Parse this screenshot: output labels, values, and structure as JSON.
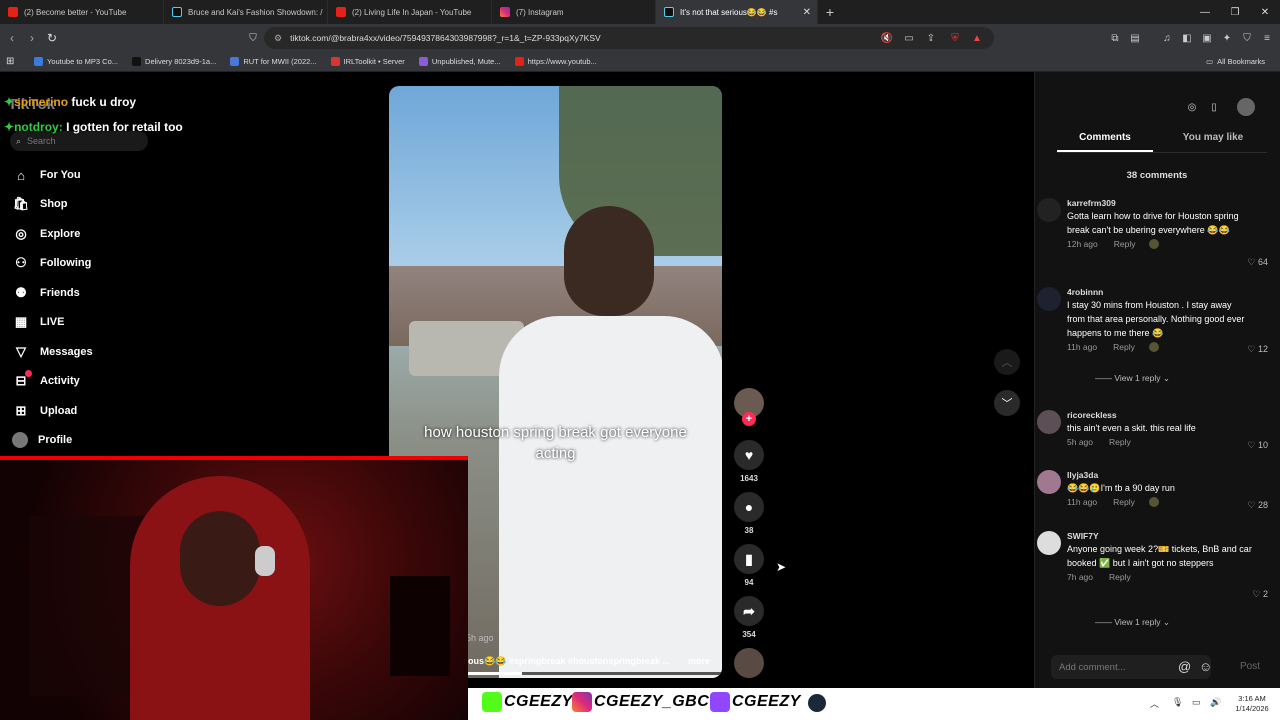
{
  "browser": {
    "tabs": [
      {
        "title": "(2) Become better - YouTube",
        "icon": "youtube-icon"
      },
      {
        "title": "Bruce and Kai's Fashion Showdown: /",
        "icon": "tiktok-icon"
      },
      {
        "title": "(2) Living Life In Japan - YouTube",
        "icon": "youtube-icon"
      },
      {
        "title": "(7) Instagram",
        "icon": "instagram-icon"
      },
      {
        "title": "It's not that serious😂😂 #s",
        "icon": "tiktok-icon"
      }
    ],
    "url": "tiktok.com/@brabra4xx/video/7594937864303987998?_r=1&_t=ZP-933pqXy7KSV",
    "bookmarks": [
      "Youtube to MP3 Co...",
      "Delivery 8023d9-1a...",
      "RUT for MWII (2022...",
      "IRLToolkit • Server",
      "Unpublished, Mute...",
      "https://www.youtub..."
    ],
    "all_bookmarks": "All Bookmarks"
  },
  "chat": [
    {
      "user": "spinerino",
      "message": "fuck u droy"
    },
    {
      "user": "notdroy:",
      "message": "I gotten for retail too"
    }
  ],
  "tiktok_nav": {
    "logo": "TikTok",
    "search_placeholder": "Search",
    "items": [
      "For You",
      "Shop",
      "Explore",
      "Following",
      "Friends",
      "LIVE",
      "Messages",
      "Activity",
      "Upload",
      "Profile"
    ]
  },
  "video": {
    "caption": "how houston spring break got everyone acting",
    "time_ago": "5h ago",
    "description": "ous😂😂 #springbreak #houstonspringbreak ...",
    "more": "more",
    "likes": "1643",
    "comments": "38",
    "saves": "94",
    "shares": "354"
  },
  "panel": {
    "tabs": [
      "Comments",
      "You may like"
    ],
    "count": "38 comments",
    "comments": [
      {
        "user": "karrefrm309",
        "text": "Gotta learn how to drive for Houston spring break can't be ubering everywhere 😂😂",
        "time": "12h ago",
        "likes": "64"
      },
      {
        "user": "4robinnn",
        "text": "I stay 30 mins from Houston . I stay away from that area personally. Nothing good ever happens to me there 😂",
        "time": "11h ago",
        "likes": "12"
      },
      {
        "user": "ricoreckless",
        "text": "this ain't even a skit. this real life",
        "time": "5h ago",
        "likes": "10"
      },
      {
        "user": "Ilyja3da",
        "text": "😂😂🥲I'm tb a 90 day run",
        "time": "11h ago",
        "likes": "28"
      },
      {
        "user": "SWIF7Y",
        "text": "Anyone going week 2?🎫 tickets, BnB and car booked ✅ but I ain't got no steppers",
        "time": "7h ago",
        "likes": "2"
      }
    ],
    "reply_label": "Reply",
    "view_replies": "View 1 reply",
    "add_comment_placeholder": "Add comment...",
    "post": "Post"
  },
  "stream": {
    "handles": [
      "CGEEZY",
      "CGEEZY_GBC",
      "CGEEZY"
    ]
  },
  "taskbar": {
    "time": "3:16 AM",
    "date": "1/14/2026"
  }
}
